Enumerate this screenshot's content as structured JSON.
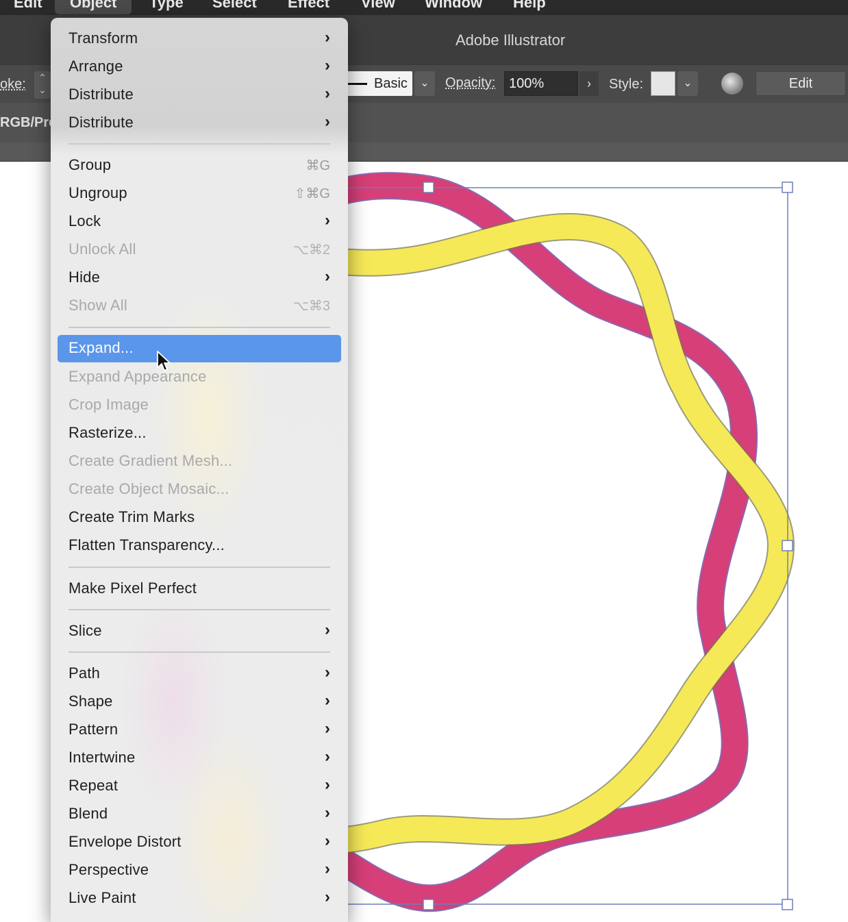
{
  "menubar": {
    "items": [
      "Edit",
      "Object",
      "Type",
      "Select",
      "Effect",
      "View",
      "Window",
      "Help"
    ],
    "active": "Object"
  },
  "app": {
    "title": "Adobe Illustrator"
  },
  "controlbar": {
    "stroke_label": "oke:",
    "brush_label": "Basic",
    "opacity_label": "Opacity:",
    "opacity_value": "100%",
    "style_label": "Style:",
    "edit_label": "Edit"
  },
  "docbar": {
    "color_mode": "RGB/Pre"
  },
  "menu": {
    "items": [
      {
        "label": "Transform",
        "submenu": true
      },
      {
        "label": "Arrange",
        "submenu": true
      },
      {
        "label": "Distribute",
        "submenu": true
      },
      {
        "label": "Distribute",
        "submenu": true
      },
      {
        "label": "Group",
        "shortcut": "⌘G"
      },
      {
        "label": "Ungroup",
        "shortcut": "⇧⌘G"
      },
      {
        "label": "Lock",
        "submenu": true
      },
      {
        "label": "Unlock All",
        "shortcut": "⌥⌘2",
        "disabled": true
      },
      {
        "label": "Hide",
        "submenu": true
      },
      {
        "label": "Show All",
        "shortcut": "⌥⌘3",
        "disabled": true
      },
      {
        "label": "Expand...",
        "highlighted": true
      },
      {
        "label": "Expand Appearance",
        "disabled": true
      },
      {
        "label": "Crop Image",
        "disabled": true
      },
      {
        "label": "Rasterize..."
      },
      {
        "label": "Create Gradient Mesh...",
        "disabled": true
      },
      {
        "label": "Create Object Mosaic...",
        "disabled": true
      },
      {
        "label": "Create Trim Marks"
      },
      {
        "label": "Flatten Transparency..."
      },
      {
        "label": "Make Pixel Perfect"
      },
      {
        "label": "Slice",
        "submenu": true
      },
      {
        "label": "Path",
        "submenu": true
      },
      {
        "label": "Shape",
        "submenu": true
      },
      {
        "label": "Pattern",
        "submenu": true
      },
      {
        "label": "Intertwine",
        "submenu": true
      },
      {
        "label": "Repeat",
        "submenu": true
      },
      {
        "label": "Blend",
        "submenu": true
      },
      {
        "label": "Envelope Distort",
        "submenu": true
      },
      {
        "label": "Perspective",
        "submenu": true
      },
      {
        "label": "Live Paint",
        "submenu": true
      }
    ],
    "submenu_arrow": "›"
  },
  "colors": {
    "magenta": "#d63f77",
    "yellow": "#f6e958",
    "highlight": "#5a96ea",
    "selection": "#6b7fb8"
  }
}
